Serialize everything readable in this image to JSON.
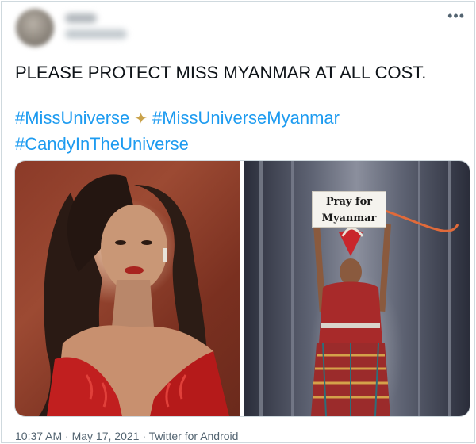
{
  "tweet": {
    "author_name": "",
    "author_handle": "",
    "more_icon": "more-horizontal-icon",
    "text": "PLEASE PROTECT MISS MYANMAR AT ALL COST.",
    "hashtags": [
      "#MissUniverse",
      "#MissUniverseMyanmar",
      "#CandyInTheUniverse"
    ],
    "sparkle_glyph": "✦",
    "media": {
      "sign_line1": "Pray for",
      "sign_line2": "Myanmar"
    },
    "timestamp": "10:37 AM · May 17, 2021 · Twitter for Android"
  },
  "colors": {
    "link": "#1d9bf0",
    "text": "#0f1419",
    "muted": "#536471",
    "border": "#cfd9de"
  }
}
